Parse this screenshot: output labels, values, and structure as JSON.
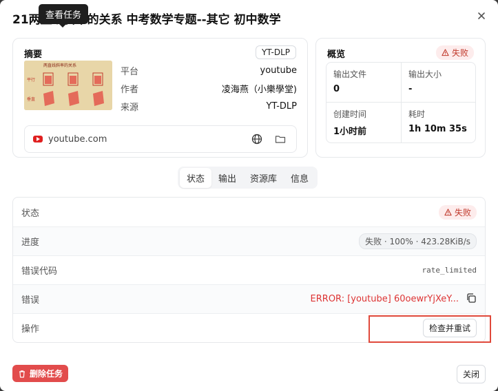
{
  "dialog": {
    "title": "21两直线斜率的关系 中考数学专题--其它 初中数学",
    "tooltip": "查看任务",
    "close_icon": "close-icon"
  },
  "summary": {
    "heading": "摘要",
    "extractor_badge": "YT-DLP",
    "thumbnail_alt": "video-thumbnail",
    "rows": [
      {
        "label": "平台",
        "value": "youtube"
      },
      {
        "label": "作者",
        "value": "凌海燕（小樂學堂)"
      },
      {
        "label": "来源",
        "value": "YT-DLP"
      }
    ],
    "source_domain": "youtube.com"
  },
  "overview": {
    "heading": "概览",
    "status_badge": "失败",
    "cells": [
      {
        "label": "输出文件",
        "value": "0"
      },
      {
        "label": "输出大小",
        "value": "-"
      },
      {
        "label": "创建时间",
        "value": "1小时前"
      },
      {
        "label": "耗时",
        "value": "1h 10m 35s"
      }
    ]
  },
  "tabs": [
    {
      "label": "状态",
      "active": true
    },
    {
      "label": "输出",
      "active": false
    },
    {
      "label": "资源库",
      "active": false
    },
    {
      "label": "信息",
      "active": false
    }
  ],
  "details": {
    "status": {
      "label": "状态",
      "value": "失败"
    },
    "progress": {
      "label": "进度",
      "value": "失败 · 100% · 423.28KiB/s"
    },
    "error_code": {
      "label": "错误代码",
      "value": "rate_limited"
    },
    "error": {
      "label": "错误",
      "value": "ERROR: [youtube] 60oewrYjXeY..."
    },
    "action": {
      "label": "操作",
      "button": "检查并重试"
    }
  },
  "footer": {
    "delete_button": "删除任务",
    "close_button": "关闭"
  },
  "colors": {
    "danger": "#e24c4c",
    "fail_text": "#c0392b",
    "highlight": "#e0483a"
  }
}
